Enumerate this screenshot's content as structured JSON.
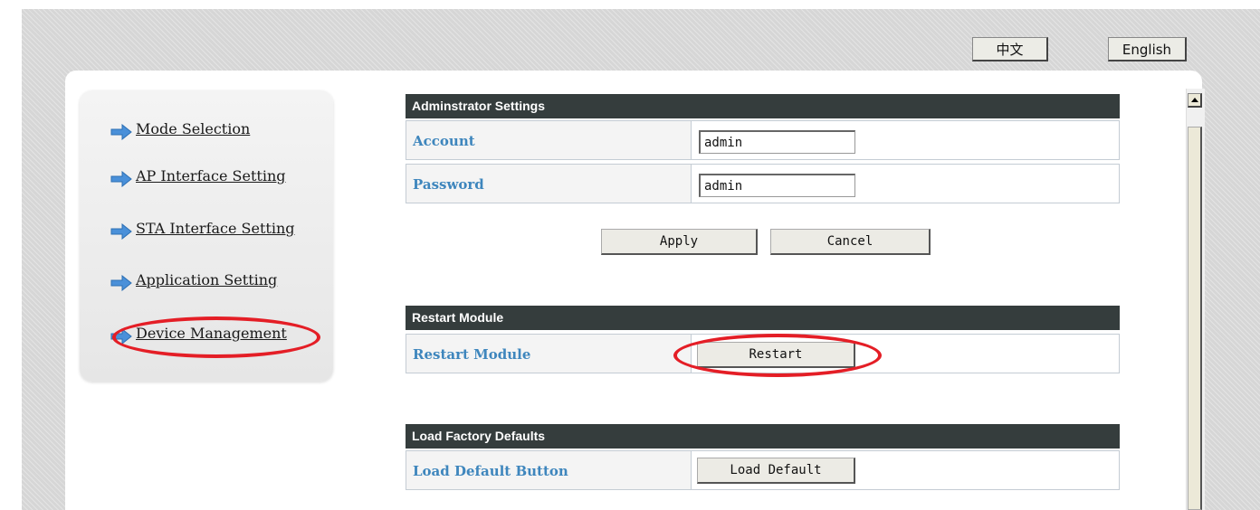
{
  "lang": {
    "chinese": "中文",
    "english": "English"
  },
  "sidebar": {
    "items": [
      {
        "label": "Mode Selection"
      },
      {
        "label": "AP Interface Setting"
      },
      {
        "label": "STA Interface Setting"
      },
      {
        "label": "Application Setting"
      },
      {
        "label": "Device Management"
      }
    ]
  },
  "admin": {
    "header": "Adminstrator Settings",
    "account_label": "Account",
    "account_value": "admin",
    "password_label": "Password",
    "password_value": "admin",
    "apply_label": "Apply",
    "cancel_label": "Cancel"
  },
  "restart": {
    "header": "Restart Module",
    "label": "Restart Module",
    "button": "Restart"
  },
  "factory": {
    "header": "Load Factory Defaults",
    "label": "Load Default Button",
    "button": "Load Default"
  },
  "colors": {
    "section_header_bg": "#353d3d",
    "label_text": "#3e86bd",
    "annotation": "#e41e26",
    "nav_arrow": "#4a90d9"
  },
  "icons": {
    "nav_arrow": "arrow-right-icon"
  }
}
